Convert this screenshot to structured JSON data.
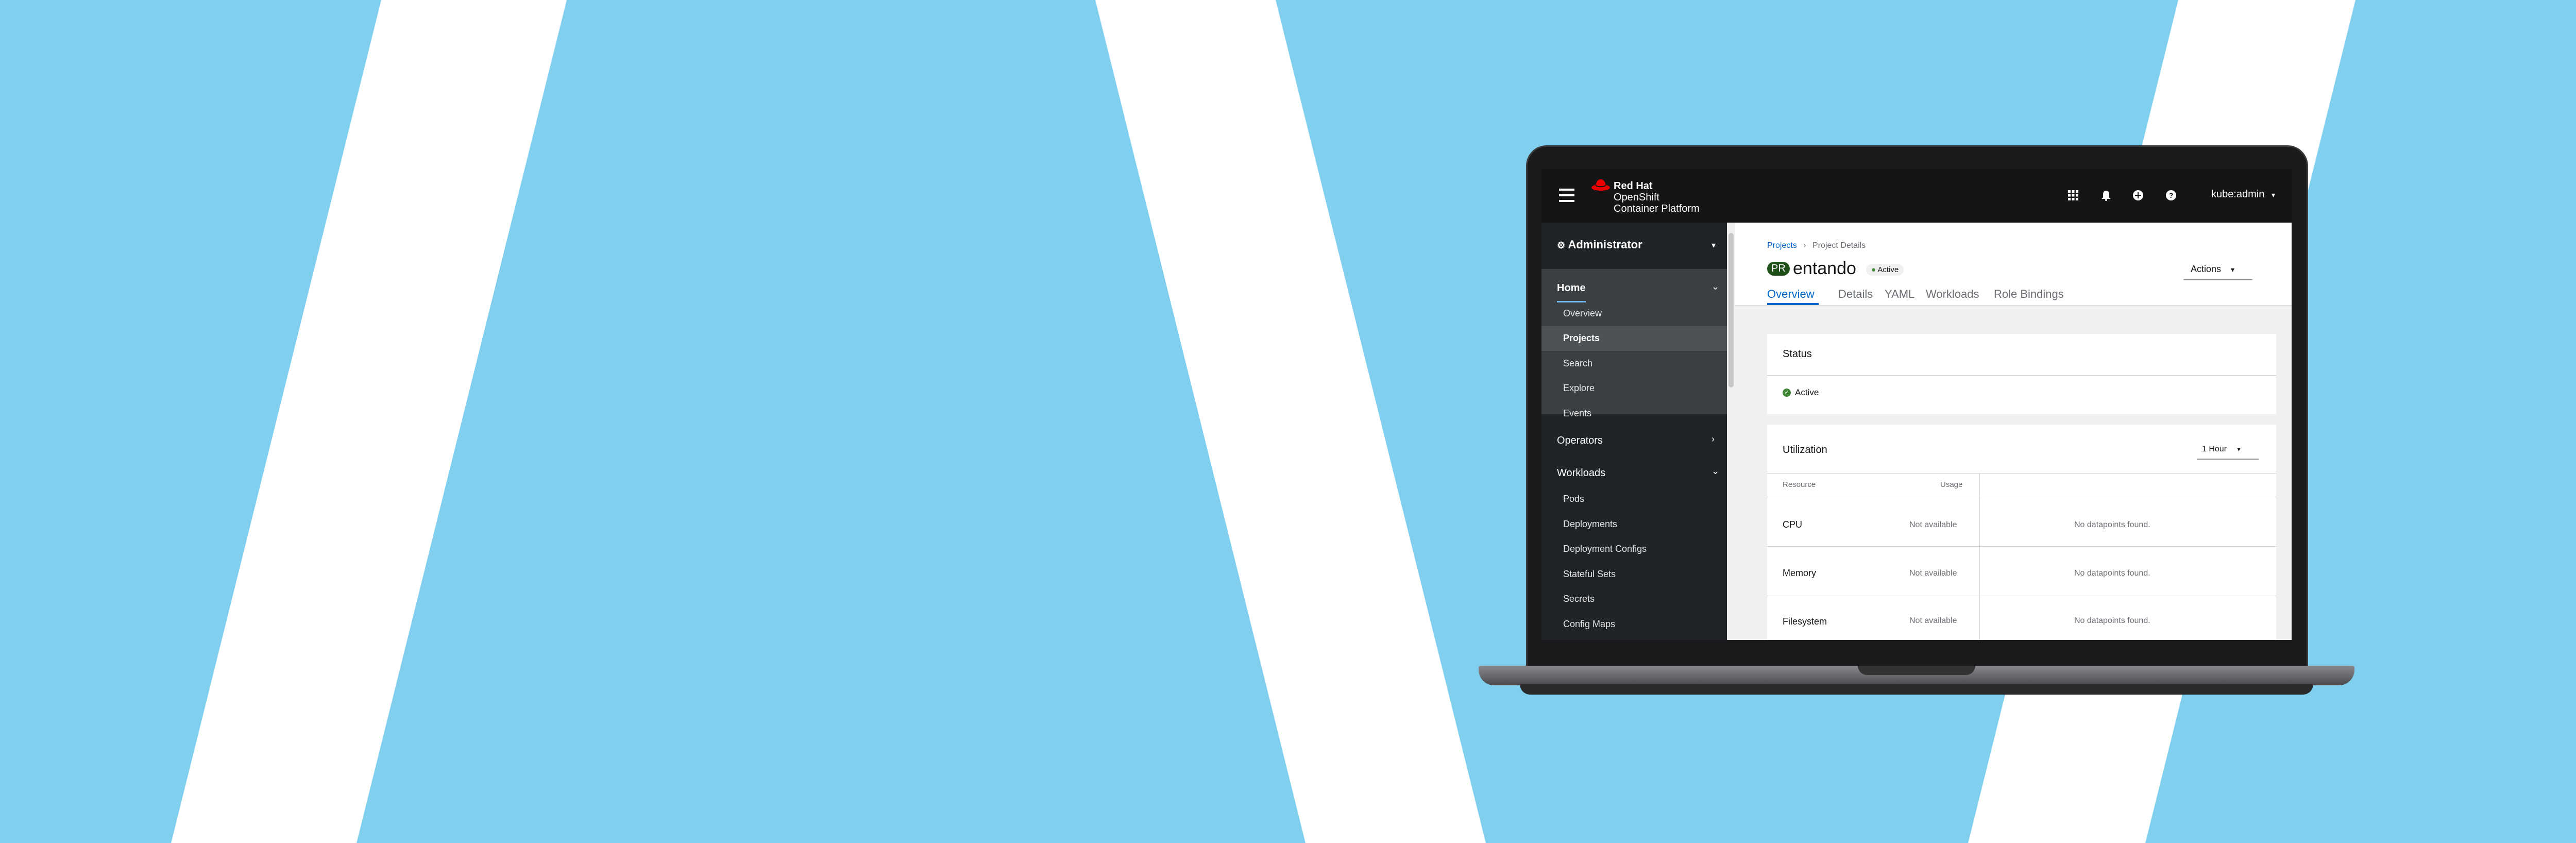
{
  "masthead": {
    "brand_line1": "Red Hat",
    "brand_line2": "OpenShift",
    "brand_line3": "Container Platform",
    "icons": [
      "grid-icon",
      "bell-icon",
      "plus-circle-icon",
      "help-icon"
    ],
    "user": "kube:admin"
  },
  "sidebar": {
    "perspective": "Administrator",
    "home": {
      "label": "Home",
      "items": [
        "Overview",
        "Projects",
        "Search",
        "Explore",
        "Events"
      ]
    },
    "operators": "Operators",
    "workloads": {
      "label": "Workloads",
      "items": [
        "Pods",
        "Deployments",
        "Deployment Configs",
        "Stateful Sets",
        "Secrets",
        "Config Maps"
      ]
    }
  },
  "main": {
    "breadcrumb": [
      "Projects",
      "Project Details"
    ],
    "project_badge": "PR",
    "project_name": "entando",
    "status_badge": "Active",
    "actions_label": "Actions",
    "tabs": [
      "Overview",
      "Details",
      "YAML",
      "Workloads",
      "Role Bindings"
    ],
    "status_card": {
      "title": "Status",
      "value": "Active"
    },
    "utilization": {
      "title": "Utilization",
      "range": "1 Hour",
      "columns": [
        "Resource",
        "Usage"
      ],
      "rows": [
        {
          "name": "CPU",
          "usage": "Not available",
          "chart": "No datapoints found."
        },
        {
          "name": "Memory",
          "usage": "Not available",
          "chart": "No datapoints found."
        },
        {
          "name": "Filesystem",
          "usage": "Not available",
          "chart": "No datapoints found."
        }
      ]
    }
  },
  "colors": {
    "background": "#80cfee",
    "masthead": "#151515",
    "sidebar": "#212427",
    "link": "#0066cc",
    "active_green": "#3e8635"
  }
}
